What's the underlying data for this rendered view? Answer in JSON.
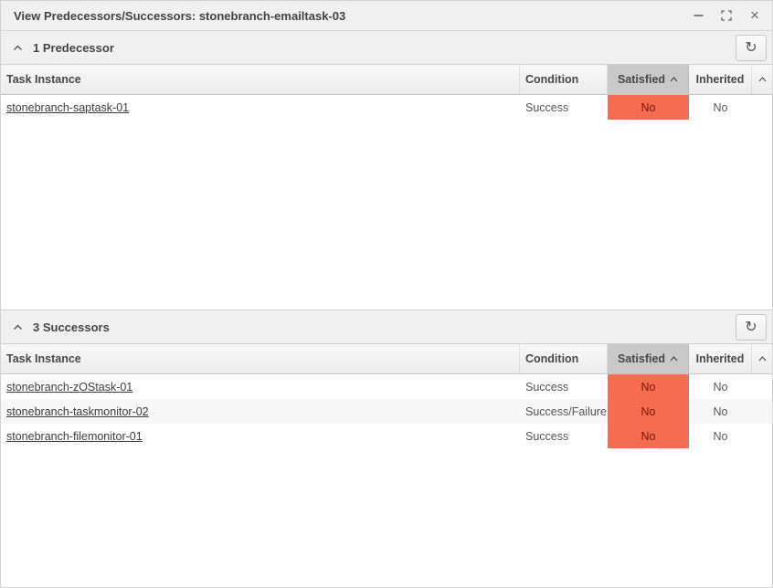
{
  "window": {
    "title": "View Predecessors/Successors: stonebranch-emailtask-03"
  },
  "icons": {
    "minimize": "minus-line",
    "maximize": "expand-corners",
    "close": "×",
    "collapse": "chevron-up",
    "refresh": "circular-arrow",
    "sort_ascending": "chevron-up",
    "corner_sort": "chevron-up"
  },
  "colors": {
    "satisfied_no_bg": "#f76b50",
    "sorted_column_header_bg": "#c9c9c9",
    "titlebar_bg": "#f0f0f0"
  },
  "grid_columns": {
    "task_instance": "Task Instance",
    "condition": "Condition",
    "satisfied": "Satisfied",
    "inherited": "Inherited"
  },
  "grid": {
    "sorted_column": "Satisfied",
    "sort_direction": "ascending"
  },
  "panels": [
    {
      "title": "1 Predecessor",
      "rows": [
        {
          "task_instance": "stonebranch-saptask-01",
          "condition": "Success",
          "satisfied": "No",
          "inherited": "No"
        }
      ]
    },
    {
      "title": "3 Successors",
      "rows": [
        {
          "task_instance": "stonebranch-zOStask-01",
          "condition": "Success",
          "satisfied": "No",
          "inherited": "No"
        },
        {
          "task_instance": "stonebranch-taskmonitor-02",
          "condition": "Success/Failure",
          "satisfied": "No",
          "inherited": "No"
        },
        {
          "task_instance": "stonebranch-filemonitor-01",
          "condition": "Success",
          "satisfied": "No",
          "inherited": "No"
        }
      ]
    }
  ]
}
